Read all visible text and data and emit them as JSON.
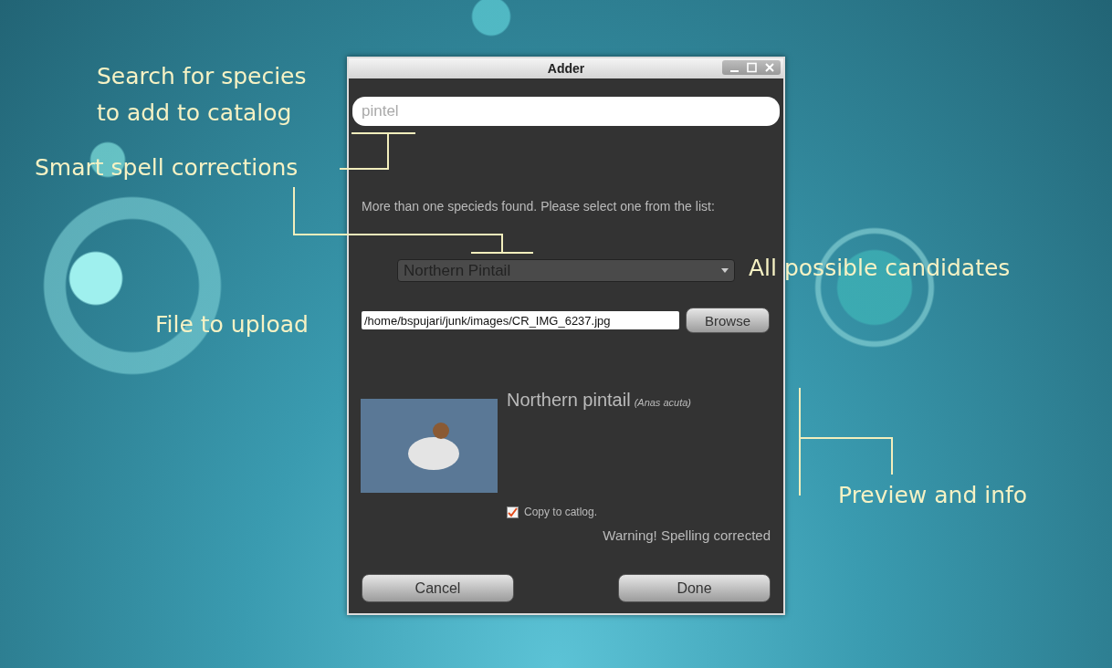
{
  "annotations": [
    {
      "text": "Search for species to add to catalog"
    },
    {
      "text": "Smart spell corrections"
    },
    {
      "text": "All possible candidates"
    },
    {
      "text": "File to upload"
    },
    {
      "text": "Preview and info"
    }
  ],
  "window": {
    "title": "Adder"
  },
  "search": {
    "placeholder": "pintel"
  },
  "message": "More than one specieds found. Please select one from the list:",
  "species_dropdown": {
    "value": "Northern Pintail"
  },
  "file": {
    "path": "/home/bspujari/junk/images/CR_IMG_6237.jpg",
    "button": "Browse"
  },
  "preview": {
    "common_name": "Northern pintail",
    "scientific_name": "(Anas acuta)"
  },
  "copy_checkbox": {
    "label": "Copy to catlog.",
    "checked": true
  },
  "warning": "Warning! Spelling corrected",
  "buttons": [
    "Cancel",
    "Done"
  ]
}
